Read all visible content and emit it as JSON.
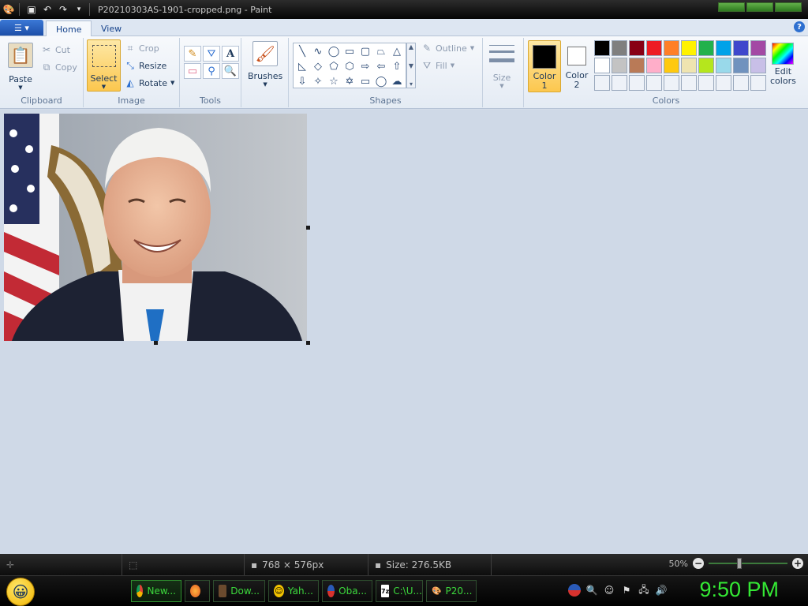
{
  "window": {
    "title": "P20210303AS-1901-cropped.png - Paint"
  },
  "ribbon_tabs": [
    {
      "label": "Home",
      "active": true
    },
    {
      "label": "View",
      "active": false
    }
  ],
  "clipboard": {
    "paste_label": "Paste",
    "cut_label": "Cut",
    "copy_label": "Copy",
    "group_label": "Clipboard"
  },
  "image_group": {
    "select_label": "Select",
    "crop_label": "Crop",
    "resize_label": "Resize",
    "rotate_label": "Rotate",
    "group_label": "Image"
  },
  "tools_group": {
    "text_tool": "A",
    "group_label": "Tools"
  },
  "brushes": {
    "label": "Brushes"
  },
  "shapes_group": {
    "outline_label": "Outline",
    "fill_label": "Fill",
    "group_label": "Shapes"
  },
  "size": {
    "label": "Size"
  },
  "colors_group": {
    "color1_label": "Color",
    "color1_num": "1",
    "color2_label": "Color",
    "color2_num": "2",
    "edit_label": "Edit",
    "edit_label2": "colors",
    "group_label": "Colors",
    "color1": "#000000",
    "color2": "#ffffff",
    "palette": [
      "#000000",
      "#7f7f7f",
      "#880015",
      "#ed1c24",
      "#ff7f27",
      "#fff200",
      "#22b14c",
      "#00a2e8",
      "#3f48cc",
      "#a349a4",
      "#ffffff",
      "#c3c3c3",
      "#b97a57",
      "#ffaec9",
      "#ffc90e",
      "#efe4b0",
      "#b5e61d",
      "#99d9ea",
      "#7092be",
      "#c8bfe7",
      "",
      "",
      "",
      "",
      "",
      "",
      "",
      "",
      "",
      ""
    ]
  },
  "status": {
    "dimensions": "768 × 576px",
    "size": "Size: 276.5KB",
    "zoom": "50%"
  },
  "taskbar": {
    "items": [
      {
        "label": "New...",
        "icon": "chrome-icon"
      },
      {
        "label": "",
        "icon": "firefox-icon"
      },
      {
        "label": "Dow...",
        "icon": "download-icon"
      },
      {
        "label": "Yah...",
        "icon": "yahoo-icon"
      },
      {
        "label": "Oba...",
        "icon": "obama-icon"
      },
      {
        "label": "C:\\U...",
        "icon": "7zip-icon"
      },
      {
        "label": "P20...",
        "icon": "paint-icon"
      }
    ],
    "clock": "9:50 PM"
  }
}
